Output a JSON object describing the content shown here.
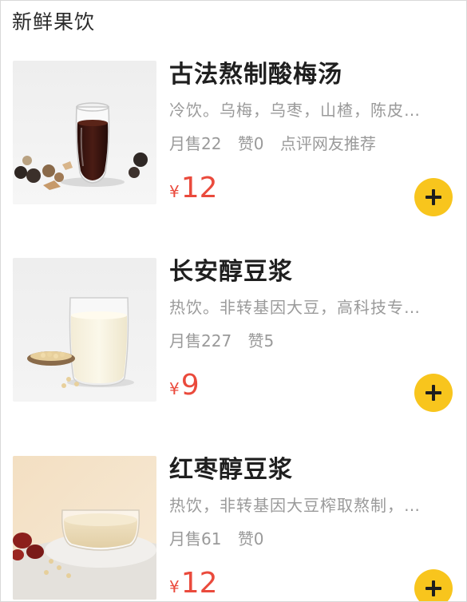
{
  "section": {
    "title": "新鲜果饮"
  },
  "currency_symbol": "¥",
  "items": [
    {
      "name": "古法熬制酸梅汤",
      "description": "冷饮。乌梅，乌枣，山楂，陈皮…",
      "sales": "月售22",
      "likes": "赞0",
      "extra": "点评网友推荐",
      "price": "12",
      "image": "sour-plum-drink-photo"
    },
    {
      "name": "长安醇豆浆",
      "description": "热饮。非转基因大豆，高科技专…",
      "sales": "月售227",
      "likes": "赞5",
      "extra": "",
      "price": "9",
      "image": "soy-milk-glass-photo"
    },
    {
      "name": "红枣醇豆浆",
      "description": "热饮，非转基因大豆榨取熬制，…",
      "sales": "月售61",
      "likes": "赞0",
      "extra": "",
      "price": "12",
      "image": "red-date-soy-milk-bowl-photo"
    }
  ],
  "colors": {
    "price": "#ea4a3c",
    "add_button": "#f8c51d",
    "muted_text": "#9a9a9a"
  },
  "icons": {
    "add": "plus-icon"
  }
}
